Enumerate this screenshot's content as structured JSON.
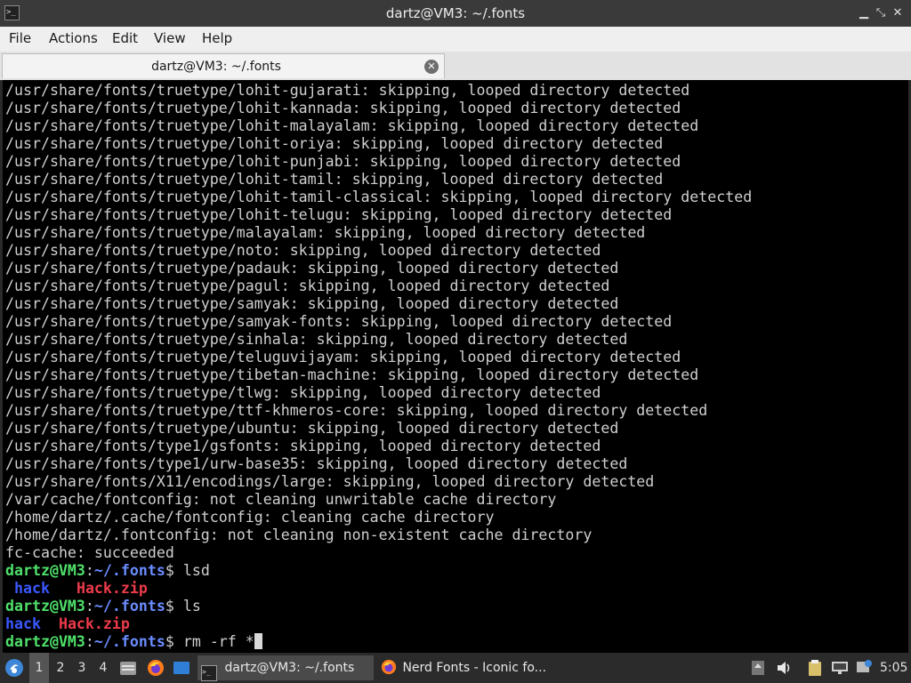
{
  "window": {
    "title": "dartz@VM3: ~/.fonts",
    "icon": "terminal-icon",
    "controls": [
      "minimize-icon",
      "maximize-icon",
      "close-icon"
    ]
  },
  "menu": {
    "file": "File",
    "actions": "Actions",
    "edit": "Edit",
    "view": "View",
    "help": "Help"
  },
  "tabs": [
    {
      "label": "dartz@VM3: ~/.fonts",
      "close_icon": "close-circle-icon"
    }
  ],
  "terminal": {
    "output_lines": [
      "/usr/share/fonts/truetype/lohit-gujarati: skipping, looped directory detected",
      "/usr/share/fonts/truetype/lohit-kannada: skipping, looped directory detected",
      "/usr/share/fonts/truetype/lohit-malayalam: skipping, looped directory detected",
      "/usr/share/fonts/truetype/lohit-oriya: skipping, looped directory detected",
      "/usr/share/fonts/truetype/lohit-punjabi: skipping, looped directory detected",
      "/usr/share/fonts/truetype/lohit-tamil: skipping, looped directory detected",
      "/usr/share/fonts/truetype/lohit-tamil-classical: skipping, looped directory detected",
      "/usr/share/fonts/truetype/lohit-telugu: skipping, looped directory detected",
      "/usr/share/fonts/truetype/malayalam: skipping, looped directory detected",
      "/usr/share/fonts/truetype/noto: skipping, looped directory detected",
      "/usr/share/fonts/truetype/padauk: skipping, looped directory detected",
      "/usr/share/fonts/truetype/pagul: skipping, looped directory detected",
      "/usr/share/fonts/truetype/samyak: skipping, looped directory detected",
      "/usr/share/fonts/truetype/samyak-fonts: skipping, looped directory detected",
      "/usr/share/fonts/truetype/sinhala: skipping, looped directory detected",
      "/usr/share/fonts/truetype/teluguvijayam: skipping, looped directory detected",
      "/usr/share/fonts/truetype/tibetan-machine: skipping, looped directory detected",
      "/usr/share/fonts/truetype/tlwg: skipping, looped directory detected",
      "/usr/share/fonts/truetype/ttf-khmeros-core: skipping, looped directory detected",
      "/usr/share/fonts/truetype/ubuntu: skipping, looped directory detected",
      "/usr/share/fonts/type1/gsfonts: skipping, looped directory detected",
      "/usr/share/fonts/type1/urw-base35: skipping, looped directory detected",
      "/usr/share/fonts/X11/encodings/large: skipping, looped directory detected",
      "/var/cache/fontconfig: not cleaning unwritable cache directory",
      "/home/dartz/.cache/fontconfig: cleaning cache directory",
      "/home/dartz/.fontconfig: not cleaning non-existent cache directory",
      "fc-cache: succeeded"
    ],
    "prompt_user": "dartz@VM3",
    "prompt_colon": ":",
    "prompt_path": "~/.fonts",
    "prompt_dollar": "$ ",
    "cmd1": "lsd",
    "lsd_dir_icon": "",
    "lsd_dir": "hack",
    "lsd_zip_icon": "",
    "lsd_zip": "Hack.zip",
    "cmd2": "ls",
    "ls_dir": "hack",
    "ls_zip": "Hack.zip",
    "cmd3": "rm -rf *",
    "colors": {
      "prompt": "#4fe06a",
      "directory": "#6a8cff",
      "archive": "#ee3b4b",
      "text": "#cfcfcf",
      "background": "#000000"
    }
  },
  "taskbar": {
    "start_icon": "start-menu-icon",
    "workspaces": [
      "1",
      "2",
      "3",
      "4"
    ],
    "active_workspace": "1",
    "launchers": [
      "file-manager-icon",
      "firefox-icon",
      "desktop-icon"
    ],
    "tasks": [
      {
        "icon": "terminal-icon",
        "label": "dartz@VM3: ~/.fonts",
        "active": true
      },
      {
        "icon": "firefox-icon",
        "label": "Nerd Fonts - Iconic fo...",
        "active": false
      }
    ],
    "tray_icons": [
      "upload-icon",
      "volume-icon",
      "clipboard-icon",
      "network-icon",
      "notification-icon"
    ],
    "clock": "5:05"
  }
}
